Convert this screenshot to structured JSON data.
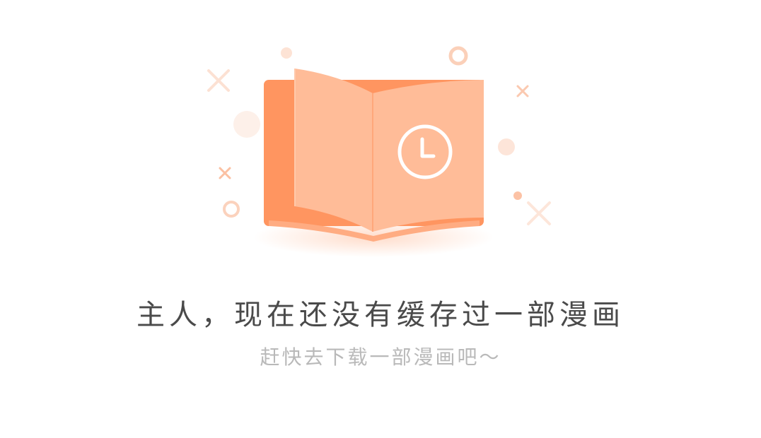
{
  "empty_state": {
    "title": "主人，现在还没有缓存过一部漫画",
    "subtitle": "赶快去下载一部漫画吧～",
    "illustration_icon": "open-book-clock-icon"
  },
  "colors": {
    "background": "#ffffff",
    "book_dark": "#ff9560",
    "book_light": "#ffbc98",
    "decoration": "#fbd8c6",
    "title_text": "#4a4a4a",
    "subtitle_text": "#b9b9b9"
  }
}
